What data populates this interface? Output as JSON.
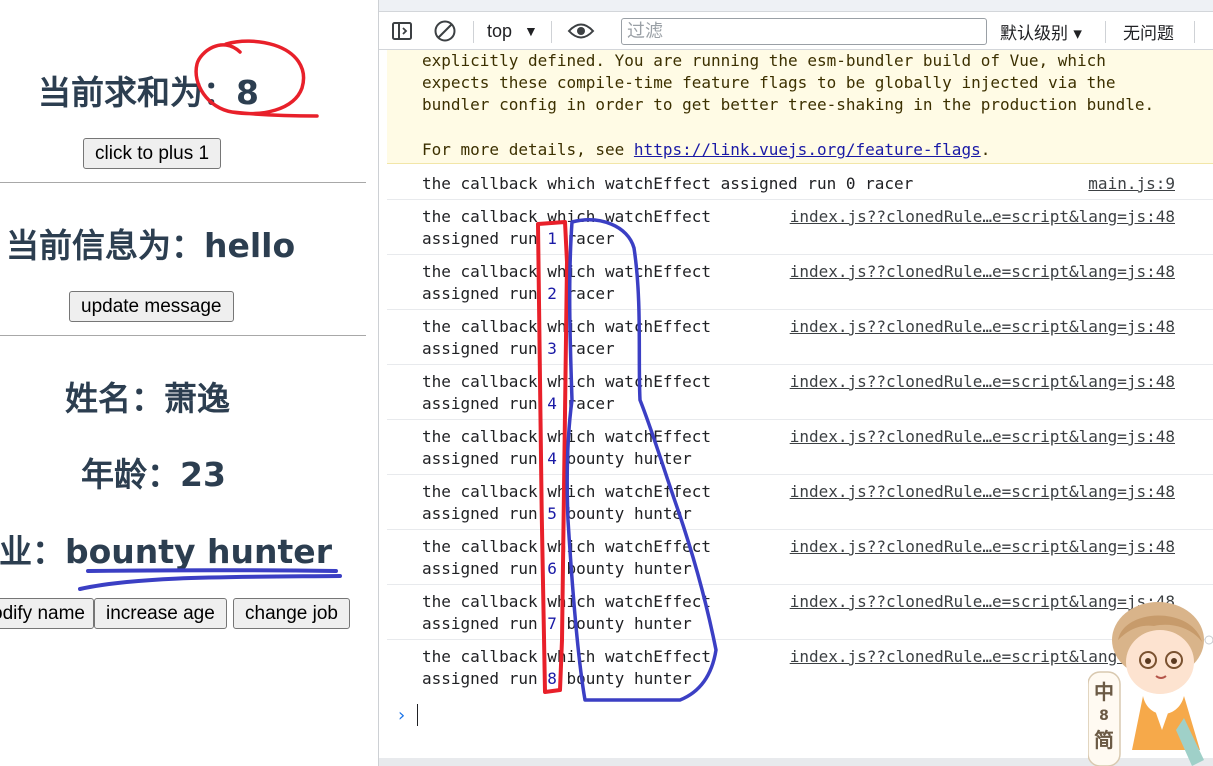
{
  "app": {
    "sum": {
      "label": "当前求和为：",
      "value": "8",
      "button": "click to plus 1"
    },
    "message": {
      "label": "当前信息为：",
      "value": "hello",
      "button": "update message"
    },
    "person": {
      "name_label": "姓名：",
      "name_value": "萧逸",
      "age_label": "年龄：",
      "age_value": "23",
      "job_label": "职业：",
      "job_value": "bounty hunter",
      "buttons": {
        "modify_name": "modify name",
        "increase_age": "increase age",
        "change_job": "change job"
      }
    }
  },
  "devtools": {
    "toolbar": {
      "context": "top",
      "filter_placeholder": "过滤",
      "level": "默认级别 ▾",
      "issues": "无问题"
    },
    "warning": {
      "lines": [
        "explicitly defined. You are running the esm-bundler build of Vue, which",
        "expects these compile-time feature flags to be globally injected via the",
        "bundler config in order to get better tree-shaking in the production bundle."
      ],
      "details_prefix": "For more details, see ",
      "details_link": "https://link.vuejs.org/feature-flags",
      "details_suffix": "."
    },
    "messages": [
      {
        "line1": "the callback which watchEffect assigned run ",
        "num": "0",
        "tail": " racer",
        "source": "main.js:9"
      },
      {
        "line1": "the callback which watchEffect",
        "line2": "assigned run ",
        "num": "1",
        "tail": " racer",
        "source": "index.js??clonedRule…e=script&lang=js:48"
      },
      {
        "line1": "the callback which watchEffect",
        "line2": "assigned run ",
        "num": "2",
        "tail": " racer",
        "source": "index.js??clonedRule…e=script&lang=js:48"
      },
      {
        "line1": "the callback which watchEffect",
        "line2": "assigned run ",
        "num": "3",
        "tail": " racer",
        "source": "index.js??clonedRule…e=script&lang=js:48"
      },
      {
        "line1": "the callback which watchEffect",
        "line2": "assigned run ",
        "num": "4",
        "tail": " racer",
        "source": "index.js??clonedRule…e=script&lang=js:48"
      },
      {
        "line1": "the callback which watchEffect",
        "line2": "assigned run ",
        "num": "4",
        "tail": " bounty hunter",
        "source": "index.js??clonedRule…e=script&lang=js:48"
      },
      {
        "line1": "the callback which watchEffect",
        "line2": "assigned run ",
        "num": "5",
        "tail": " bounty hunter",
        "source": "index.js??clonedRule…e=script&lang=js:48"
      },
      {
        "line1": "the callback which watchEffect",
        "line2": "assigned run ",
        "num": "6",
        "tail": " bounty hunter",
        "source": "index.js??clonedRule…e=script&lang=js:48"
      },
      {
        "line1": "the callback which watchEffect",
        "line2": "assigned run ",
        "num": "7",
        "tail": " bounty hunter",
        "source": "index.js??clonedRule…e=script&lang=js:48"
      },
      {
        "line1": "the callback which watchEffect",
        "line2": "assigned run ",
        "num": "8",
        "tail": " bounty hunter",
        "source": "index.js??clonedRule…e=script&lang=js:48"
      }
    ]
  },
  "ime": {
    "mode": "中",
    "separator": "8",
    "script": "简"
  },
  "colors": {
    "annotation_red": "#e8202a",
    "annotation_blue": "#3b3fc4",
    "link_blue": "#1a1aa6",
    "warning_bg": "#fffbe5"
  }
}
